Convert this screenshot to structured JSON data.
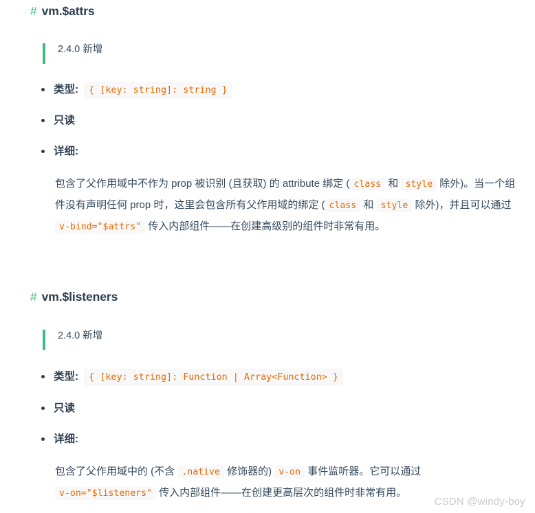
{
  "page": {
    "background": "#ffffff",
    "accent_green": "#42b983",
    "code_color": "#e96900",
    "code_background": "#f8f8f8",
    "text_color": "#2c3e50"
  },
  "sections": [
    {
      "anchor": "#",
      "title": "vm.$attrs",
      "version_note": "2.4.0 新增",
      "type_label": "类型:",
      "type_value": "{ [key: string]: string }",
      "readonly_label": "只读",
      "detail_label": "详细:",
      "detail": {
        "p1": "包含了父作用域中不作为 prop 被识别 (且获取) 的 attribute 绑定 (",
        "c1": "class",
        "p2": " 和 ",
        "c2": "style",
        "p3": " 除外)。当一个组件没有声明任何 prop 时，这里会包含所有父作用域的绑定 (",
        "c3": "class",
        "p4": " 和 ",
        "c4": "style",
        "p5": " 除外)，并且可以通过 ",
        "c5": "v-bind=\"$attrs\"",
        "p6": " 传入内部组件——在创建高级别的组件时非常有用。"
      }
    },
    {
      "anchor": "#",
      "title": "vm.$listeners",
      "version_note": "2.4.0 新增",
      "type_label": "类型:",
      "type_value": "{ [key: string]: Function | Array<Function> }",
      "readonly_label": "只读",
      "detail_label": "详细:",
      "detail": {
        "p1": "包含了父作用域中的 (不含 ",
        "c1": ".native",
        "p2": " 修饰器的) ",
        "c2": "v-on",
        "p3": " 事件监听器。它可以通过 ",
        "c3": "v-on=\"$listeners\"",
        "p4": " 传入内部组件——在创建更高层次的组件时非常有用。"
      }
    }
  ],
  "watermark": "CSDN @windy-boy"
}
